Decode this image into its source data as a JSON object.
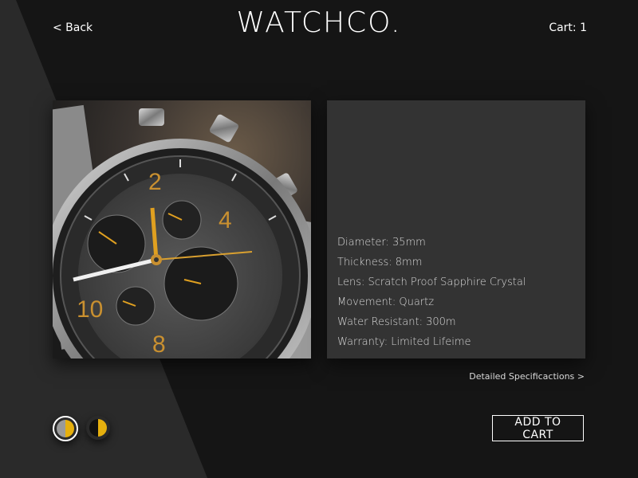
{
  "header": {
    "back_label": "< Back",
    "logo": "WATCHCO.",
    "cart_label": "Cart: 1"
  },
  "product": {
    "image_icon": "watch-chronograph-photo",
    "specs": [
      "Diameter: 35mm",
      "Thickness: 8mm",
      "Lens: Scratch Proof Sapphire Crystal",
      "Movement: Quartz",
      "Water Resistant: 300m",
      "Warranty: Limited Lifeime"
    ],
    "details_link": "Detailed Specificactions >"
  },
  "swatches": [
    {
      "left_color": "#9a9a9a",
      "right_color": "#e6b00e",
      "selected": true
    },
    {
      "left_color": "#111111",
      "right_color": "#e6b00e",
      "selected": false
    }
  ],
  "actions": {
    "add_to_cart": "ADD TO CART"
  },
  "colors": {
    "background": "#151515",
    "panel": "#333333",
    "accent": "#e6b00e"
  }
}
